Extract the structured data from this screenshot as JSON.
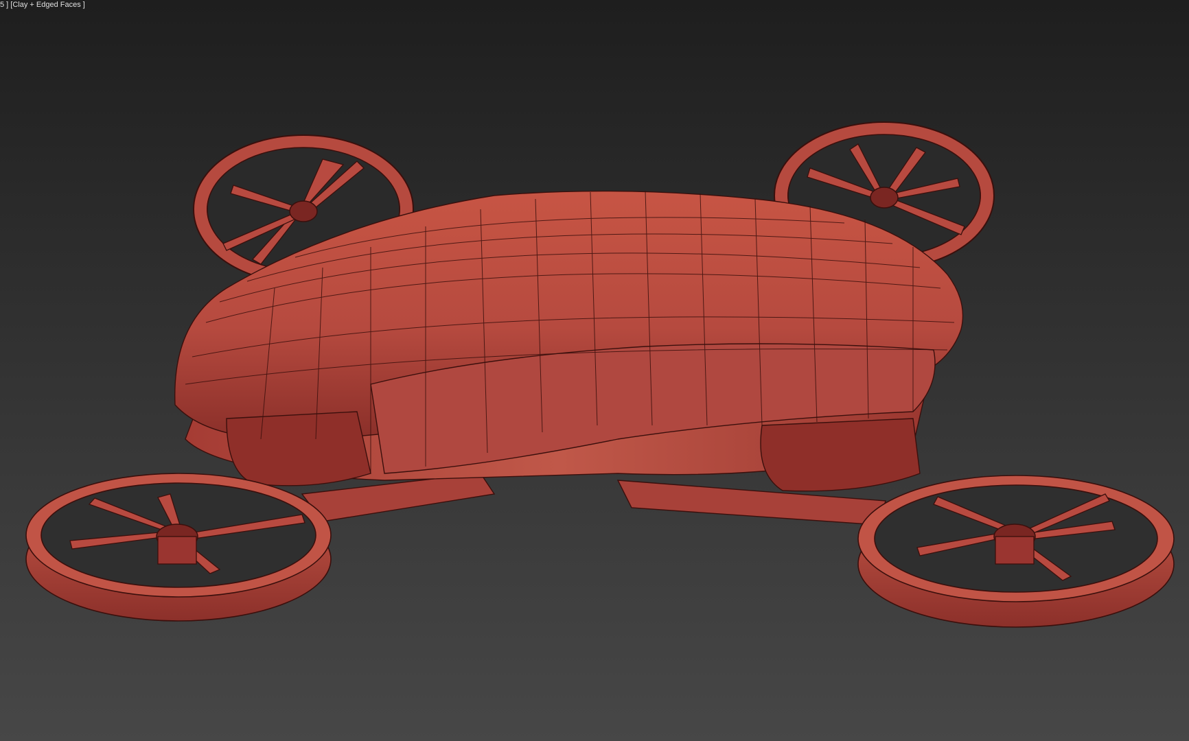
{
  "viewport": {
    "label_prefix": "5 ]",
    "label_mode": "[Clay + Edged Faces ]",
    "background_top": "#1e1e1e",
    "background_bottom": "#474747"
  },
  "model": {
    "name": "drone-car",
    "fill_color": "#b84a40",
    "fill_light": "#d3604f",
    "fill_dark": "#7a2622",
    "wire_color": "#3a0f0c"
  },
  "icons": {
    "rotor": "rotor-icon"
  }
}
